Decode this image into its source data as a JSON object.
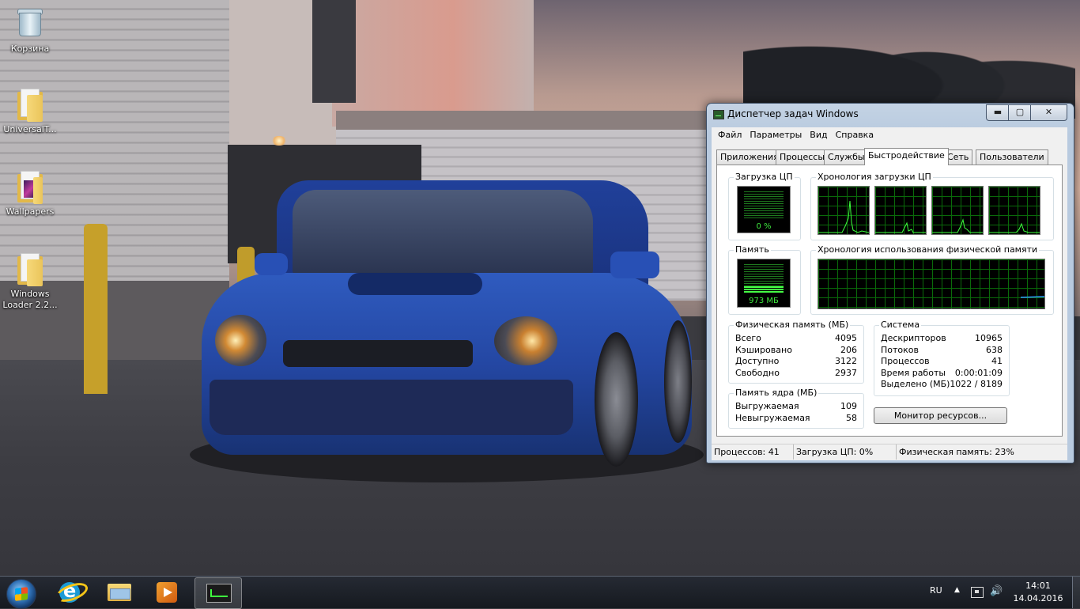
{
  "desktop": {
    "icons": [
      {
        "label": "Корзина",
        "icon": "recycle-bin-icon"
      },
      {
        "label": "UniversalT...",
        "icon": "folder-icon"
      },
      {
        "label": "Wallpapers",
        "icon": "folder-icon"
      },
      {
        "label": "Windows Loader 2.2...",
        "icon": "folder-icon"
      }
    ]
  },
  "taskmgr": {
    "title": "Диспетчер задач Windows",
    "caption": {
      "minimize": "▬",
      "maximize": "▢",
      "close": "✕"
    },
    "menu": [
      "Файл",
      "Параметры",
      "Вид",
      "Справка"
    ],
    "tabs": [
      "Приложения",
      "Процессы",
      "Службы",
      "Быстродействие",
      "Сеть",
      "Пользователи"
    ],
    "active_tab": "Быстродействие",
    "cpu": {
      "label": "Загрузка ЦП",
      "value": "0 %",
      "percent": 0
    },
    "cpu_history": {
      "label": "Хронология загрузки ЦП"
    },
    "memory": {
      "label": "Память",
      "value": "973 МБ",
      "percent": 23
    },
    "memory_history": {
      "label": "Хронология использования физической памяти"
    },
    "physical": {
      "label": "Физическая память (МБ)",
      "rows": [
        {
          "k": "Всего",
          "v": "4095"
        },
        {
          "k": "Кэшировано",
          "v": "206"
        },
        {
          "k": "Доступно",
          "v": "3122"
        },
        {
          "k": "Свободно",
          "v": "2937"
        }
      ]
    },
    "kernel": {
      "label": "Память ядра (МБ)",
      "rows": [
        {
          "k": "Выгружаемая",
          "v": "109"
        },
        {
          "k": "Невыгружаемая",
          "v": "58"
        }
      ]
    },
    "system": {
      "label": "Система",
      "rows": [
        {
          "k": "Дескрипторов",
          "v": "10965"
        },
        {
          "k": "Потоков",
          "v": "638"
        },
        {
          "k": "Процессов",
          "v": "41"
        },
        {
          "k": "Время работы",
          "v": "0:00:01:09"
        },
        {
          "k": "Выделено (МБ)",
          "v": "1022 / 8189"
        }
      ]
    },
    "resmon_button": "Монитор ресурсов...",
    "status": {
      "processes": "Процессов: 41",
      "cpu": "Загрузка ЦП: 0%",
      "memory": "Физическая память: 23%"
    }
  },
  "taskbar": {
    "pinned": [
      {
        "name": "internet-explorer",
        "icon": "internet-explorer-icon"
      },
      {
        "name": "file-explorer",
        "icon": "folder-library-icon"
      },
      {
        "name": "media-player",
        "icon": "media-player-icon"
      },
      {
        "name": "task-manager",
        "icon": "task-manager-icon",
        "active": true
      }
    ],
    "tray": {
      "language": "RU",
      "time": "14:01",
      "date": "14.04.2016"
    }
  },
  "colors": {
    "graph_line": "#3eff3e",
    "memory_line": "#2f9bff",
    "grid": "#0a6a0a"
  }
}
